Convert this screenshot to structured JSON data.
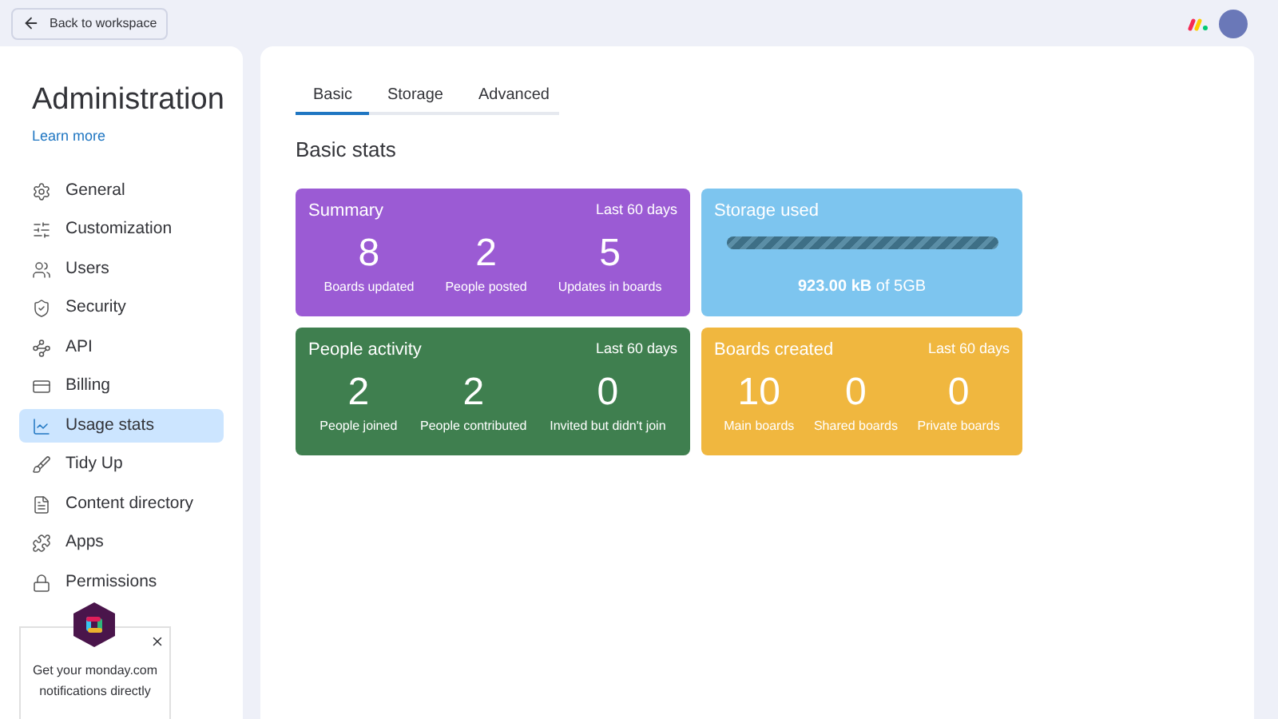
{
  "top_bar": {
    "back_button": "Back to workspace"
  },
  "sidebar": {
    "title": "Administration",
    "link": "Learn more",
    "items": [
      {
        "label": "General",
        "selected": false
      },
      {
        "label": "Customization",
        "selected": false
      },
      {
        "label": "Users",
        "selected": false
      },
      {
        "label": "Security",
        "selected": false
      },
      {
        "label": "API",
        "selected": false
      },
      {
        "label": "Billing",
        "selected": false
      },
      {
        "label": "Usage stats",
        "selected": true
      },
      {
        "label": "Tidy Up",
        "selected": false
      },
      {
        "label": "Content directory",
        "selected": false
      },
      {
        "label": "Apps",
        "selected": false
      },
      {
        "label": "Permissions",
        "selected": false
      }
    ]
  },
  "popup": {
    "text": "Get your monday.com notifications directly"
  },
  "tabs": [
    {
      "label": "Basic",
      "selected": true
    },
    {
      "label": "Storage",
      "selected": false
    },
    {
      "label": "Advanced",
      "selected": false
    }
  ],
  "heading": "Basic stats",
  "cards": [
    {
      "kind": "stats",
      "title": "Summary",
      "period": "Last 60 days",
      "color": "#9b5bd4",
      "stats": [
        {
          "value": "8",
          "label": "Boards updated"
        },
        {
          "value": "2",
          "label": "People posted"
        },
        {
          "value": "5",
          "label": "Updates in boards"
        }
      ]
    },
    {
      "kind": "storage",
      "title": "Storage used",
      "color": "#7dc5ef",
      "reading": "**923.00 kB** of 5GB"
    },
    {
      "kind": "stats",
      "title": "People activity",
      "period": "Last 60 days",
      "color": "#3f7f4f",
      "stats": [
        {
          "value": "2",
          "label": "People joined"
        },
        {
          "value": "2",
          "label": "People contributed"
        },
        {
          "value": "0",
          "label": "Invited but didn't join"
        }
      ]
    },
    {
      "kind": "stats",
      "title": "Boards created",
      "period": "Last 60 days",
      "color": "#f0b73f",
      "stats": [
        {
          "value": "10",
          "label": "Main boards"
        },
        {
          "value": "0",
          "label": "Shared boards"
        },
        {
          "value": "0",
          "label": "Private boards"
        }
      ]
    }
  ]
}
